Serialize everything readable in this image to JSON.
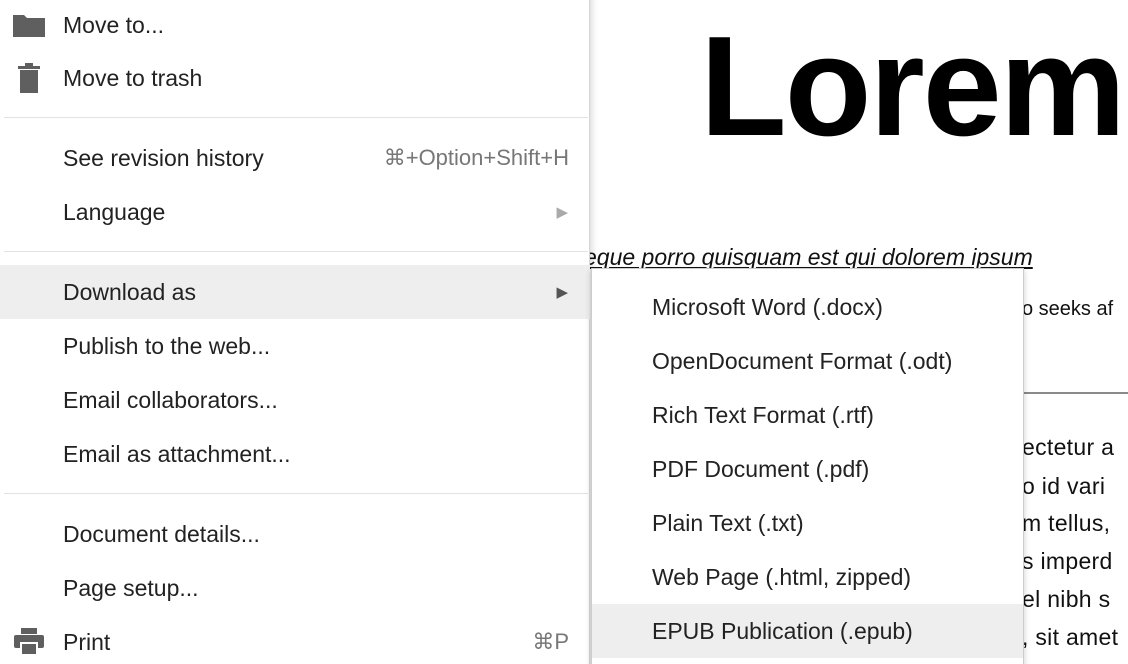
{
  "document": {
    "title": "Lorem",
    "quote": "eque porro quisquam est qui dolorem ipsum",
    "subtitle": "o seeks af",
    "body_fragments": [
      "ectetur a",
      "o id vari",
      "m tellus,",
      "s imperd",
      "el nibh s",
      ", sit amet"
    ]
  },
  "menu": {
    "move_to": "Move to...",
    "move_to_trash": "Move to trash",
    "revision_history": "See revision history",
    "revision_history_shortcut": "⌘+Option+Shift+H",
    "language": "Language",
    "download_as": "Download as",
    "publish": "Publish to the web...",
    "email_collaborators": "Email collaborators...",
    "email_attachment": "Email as attachment...",
    "document_details": "Document details...",
    "page_setup": "Page setup...",
    "print": "Print",
    "print_shortcut": "⌘P",
    "submenu_arrow": "▶"
  },
  "download_submenu": {
    "items": [
      "Microsoft Word (.docx)",
      "OpenDocument Format (.odt)",
      "Rich Text Format (.rtf)",
      "PDF Document (.pdf)",
      "Plain Text (.txt)",
      "Web Page (.html, zipped)",
      "EPUB Publication (.epub)"
    ],
    "highlighted_item": "EPUB Publication (.epub)"
  },
  "icons": {
    "move_to": "folder-icon",
    "move_to_trash": "trash-icon",
    "print": "printer-icon"
  },
  "colors": {
    "highlight": "#eeeeee",
    "icon": "#5f5f5f",
    "shortcut": "#777777"
  }
}
